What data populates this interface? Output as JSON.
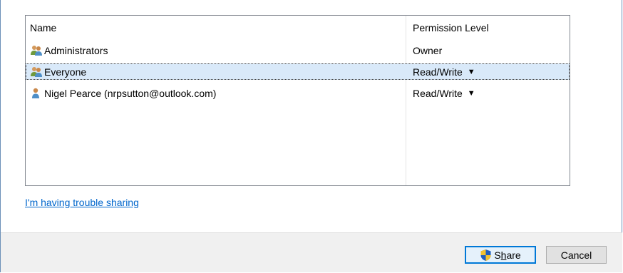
{
  "list": {
    "columns": {
      "name": "Name",
      "permission": "Permission Level"
    },
    "rows": [
      {
        "name": "Administrators",
        "permission": "Owner",
        "icon": "group-icon",
        "has_dropdown": false,
        "selected": false
      },
      {
        "name": "Everyone",
        "permission": "Read/Write",
        "icon": "group-icon",
        "has_dropdown": true,
        "selected": true
      },
      {
        "name": "Nigel Pearce (nrpsutton@outlook.com)",
        "permission": "Read/Write",
        "icon": "user-icon",
        "has_dropdown": true,
        "selected": false
      }
    ],
    "dropdown_glyph": "▼"
  },
  "trouble_link": "I'm having trouble sharing",
  "buttons": {
    "share_prefix": "S",
    "share_accel": "h",
    "share_rest": "are",
    "cancel": "Cancel"
  },
  "colors": {
    "link": "#0066cc",
    "selection": "#d9e9f9",
    "accent": "#0078d7"
  }
}
